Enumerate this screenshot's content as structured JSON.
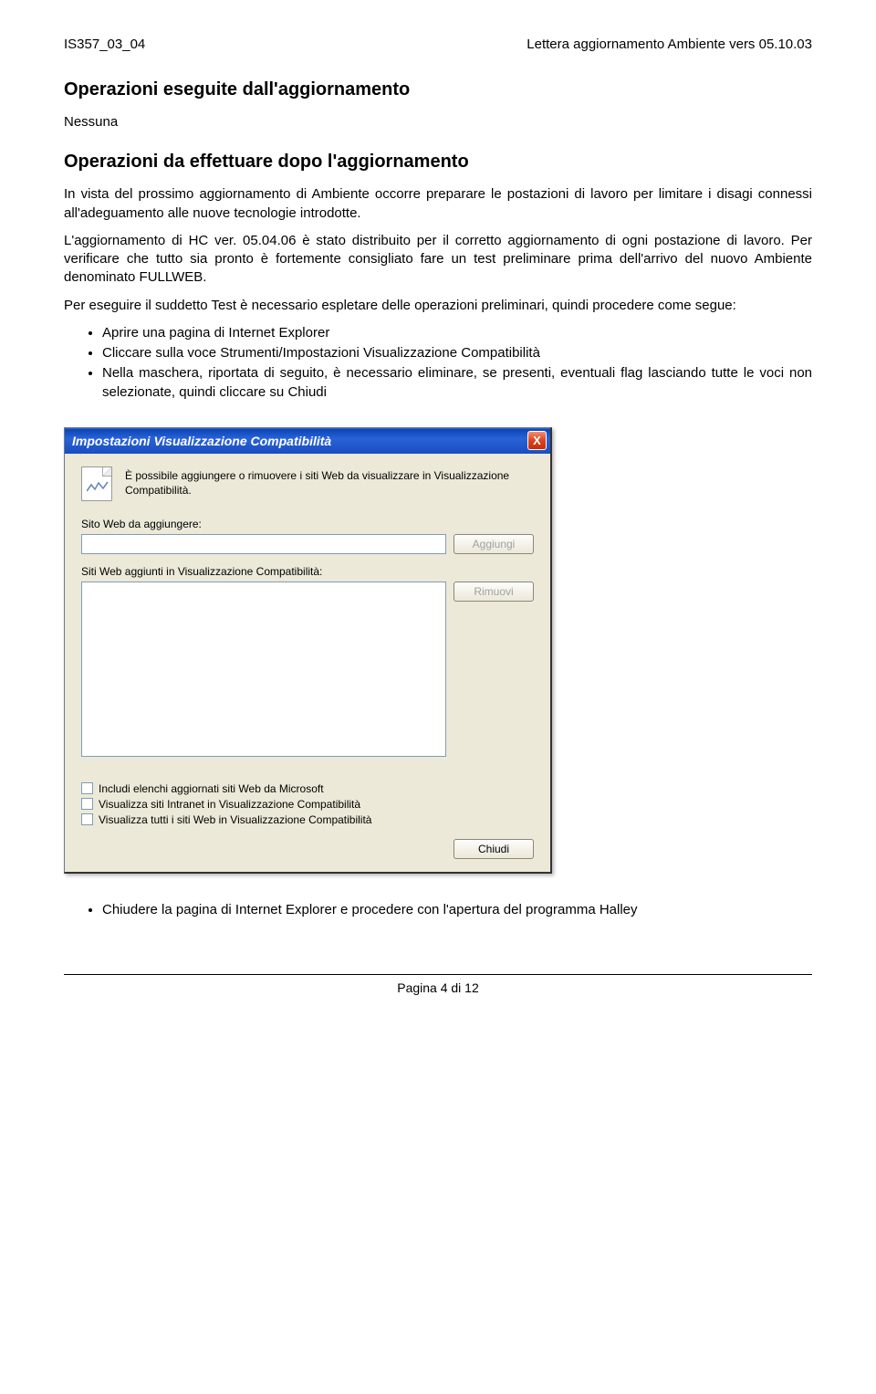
{
  "header": {
    "left": "IS357_03_04",
    "right": "Lettera aggiornamento Ambiente vers 05.10.03"
  },
  "section1": {
    "title": "Operazioni eseguite dall'aggiornamento",
    "body": "Nessuna"
  },
  "section2": {
    "title": "Operazioni da effettuare dopo l'aggiornamento",
    "para1": "In vista del prossimo aggiornamento di Ambiente occorre preparare le postazioni di lavoro per limitare i disagi connessi all'adeguamento alle nuove tecnologie introdotte.",
    "para2": "L'aggiornamento di HC ver. 05.04.06 è stato distribuito per il corretto aggiornamento di ogni postazione di lavoro. Per verificare che tutto sia pronto è fortemente consigliato fare un test preliminare prima dell'arrivo del nuovo Ambiente denominato FULLWEB.",
    "para3": "Per eseguire il suddetto Test è necessario espletare delle operazioni preliminari, quindi procedere come segue:",
    "bullets": [
      "Aprire una pagina di Internet Explorer",
      "Cliccare sulla voce Strumenti/Impostazioni Visualizzazione Compatibilità",
      "Nella maschera, riportata di seguito, è necessario eliminare, se presenti, eventuali flag lasciando tutte le voci  non selezionate, quindi cliccare su Chiudi"
    ]
  },
  "dialog": {
    "title": "Impostazioni Visualizzazione Compatibilità",
    "close_label": "X",
    "intro": "È possibile aggiungere o rimuovere i siti Web da visualizzare in Visualizzazione Compatibilità.",
    "site_label": "Sito Web da aggiungere:",
    "add_button": "Aggiungi",
    "list_label": "Siti Web aggiunti in Visualizzazione Compatibilità:",
    "remove_button": "Rimuovi",
    "checkbox1": "Includi elenchi aggiornati siti Web da Microsoft",
    "checkbox2": "Visualizza siti Intranet in Visualizzazione Compatibilità",
    "checkbox3": "Visualizza tutti i siti Web in Visualizzazione Compatibilità",
    "close_button": "Chiudi"
  },
  "after_bullet": "Chiudere la pagina di Internet Explorer e procedere con l'apertura del programma Halley",
  "footer": "Pagina 4 di 12"
}
